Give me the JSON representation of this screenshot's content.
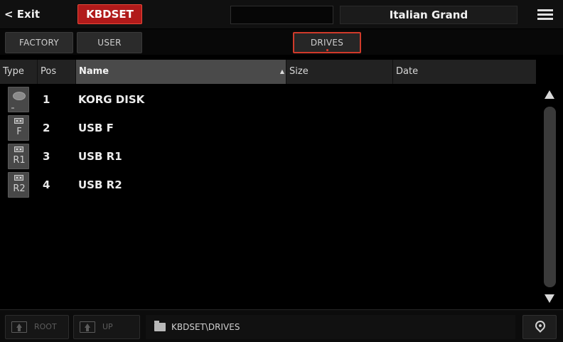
{
  "topbar": {
    "exit_label": "< Exit",
    "page_title": "KBDSET",
    "blank_field": "",
    "sound_name": "Italian Grand",
    "menu_icon": "hamburger-menu-icon"
  },
  "tabs": {
    "factory": "FACTORY",
    "user": "USER",
    "drives": "DRIVES"
  },
  "table": {
    "headers": {
      "type": "Type",
      "pos": "Pos",
      "name": "Name",
      "size": "Size",
      "date": "Date"
    },
    "rows": [
      {
        "type_label": "",
        "type_icon": "hard-disk-icon",
        "pos": "1",
        "name": "KORG DISK"
      },
      {
        "type_label": "F",
        "type_icon": "usb-drive-icon",
        "pos": "2",
        "name": "USB F"
      },
      {
        "type_label": "R1",
        "type_icon": "usb-drive-icon",
        "pos": "3",
        "name": "USB R1"
      },
      {
        "type_label": "R2",
        "type_icon": "usb-drive-icon",
        "pos": "4",
        "name": "USB R2"
      }
    ]
  },
  "footer": {
    "root_label": "ROOT",
    "up_label": "UP",
    "path": "KBDSET\\DRIVES"
  },
  "colors": {
    "accent_red": "#b11a1a",
    "selected_outline": "#d03a2a",
    "background": "#000000"
  }
}
